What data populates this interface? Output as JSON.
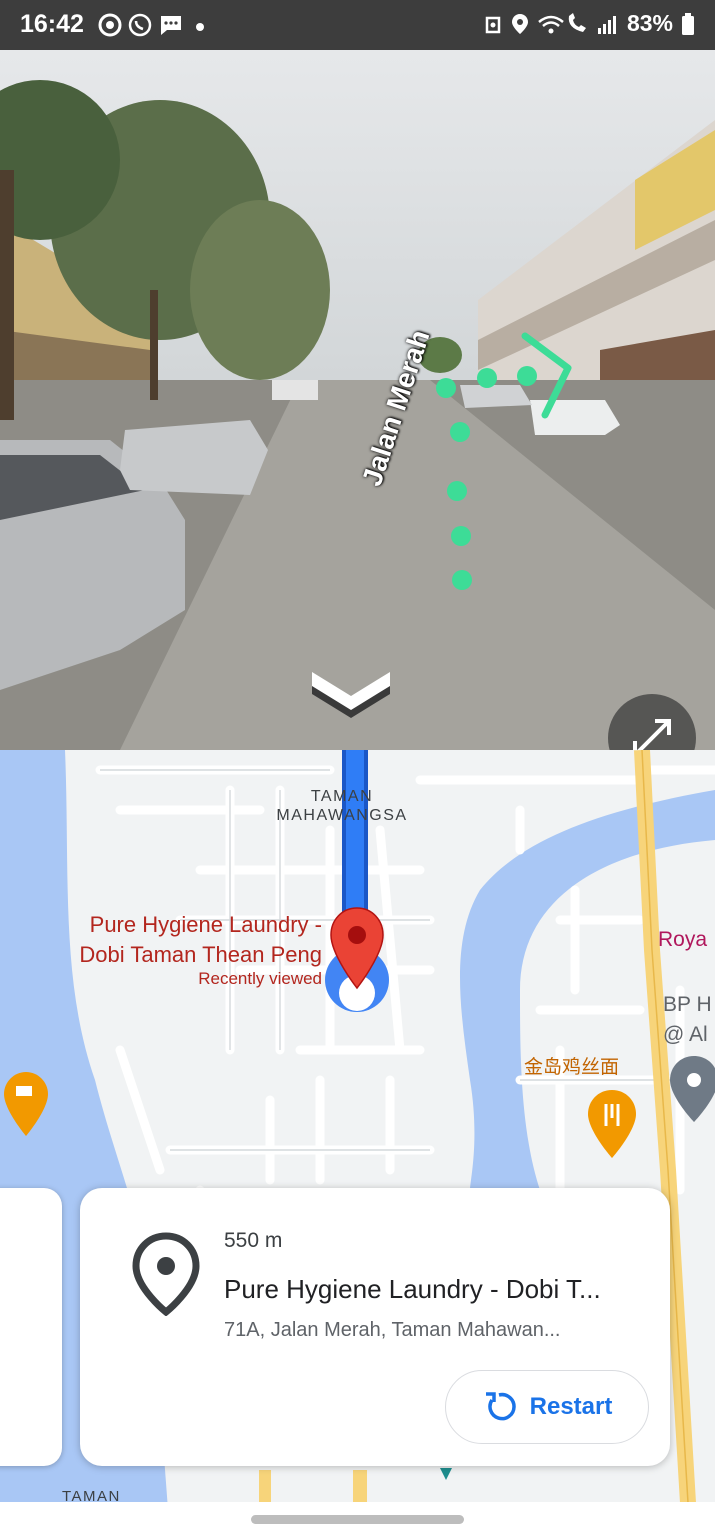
{
  "status_bar": {
    "time": "16:42",
    "battery": "83%",
    "left_icons": [
      "chrome-icon",
      "whatsapp-icon",
      "messages-icon",
      "dot-icon"
    ],
    "right_icons": [
      "alarm-icon",
      "location-icon",
      "wifi-calling-icon",
      "signal-icon",
      "battery-icon"
    ]
  },
  "street_view": {
    "road_label": "Jalan Merah",
    "chevron_icon": "chevron-down-icon",
    "expand_icon": "expand-icon",
    "route_color": "#3ddc97"
  },
  "map": {
    "area_label": "TAMAN\nMAHAWANGSA",
    "place_name": "Pure Hygiene Laundry - Dobi Taman Thean Peng",
    "place_sub": "Recently viewed",
    "poi_royal": "Roya",
    "poi_bp": "BP H\n@ Al",
    "poi_chinese": "金岛鸡丝面",
    "bottom_label": "TAMAN",
    "route_color": "#1a73e8",
    "pin_color": "#ea4335"
  },
  "card": {
    "distance": "550 m",
    "title": "Pure Hygiene Laundry - Dobi T...",
    "address": "71A, Jalan Merah, Taman Mahawan...",
    "restart_label": "Restart"
  }
}
